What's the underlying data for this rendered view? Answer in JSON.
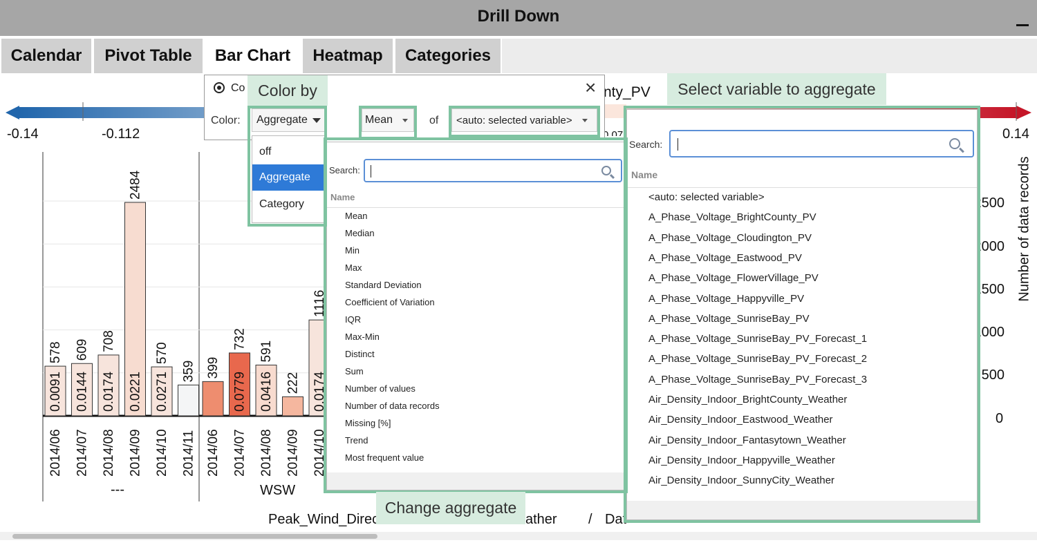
{
  "window": {
    "title": "Drill Down"
  },
  "tabs": [
    {
      "label": "Calendar",
      "active": false
    },
    {
      "label": "Pivot Table",
      "active": false
    },
    {
      "label": "Bar Chart",
      "active": true
    },
    {
      "label": "Heatmap",
      "active": false
    },
    {
      "label": "Categories",
      "active": false
    }
  ],
  "colorbar": {
    "min_label": "-0.14",
    "tick2": "-0.112",
    "max_label": "0.14",
    "low_color": "#2166ac",
    "high_color": "#c51628",
    "partial_title": "nty_PV",
    "partial_tick": "0.07"
  },
  "color_popup": {
    "title_partial": "Co",
    "color_label": "Color:",
    "color_value": "Aggregate",
    "aggregate_value": "Mean",
    "of_label": "of",
    "variable_value": "<auto: selected variable>",
    "close": "×",
    "color_options": [
      "off",
      "Aggregate",
      "Category"
    ],
    "selected_color_option": "Aggregate"
  },
  "aggregate_dropdown": {
    "search_label": "Search:",
    "search_value": "",
    "column_header": "Name",
    "items": [
      "Mean",
      "Median",
      "Min",
      "Max",
      "Standard Deviation",
      "Coefficient of Variation",
      "IQR",
      "Max-Min",
      "Distinct",
      "Sum",
      "Number of values",
      "Number of data records",
      "Missing [%]",
      "Trend",
      "Most frequent value"
    ]
  },
  "variable_dropdown": {
    "search_label": "Search:",
    "search_value": "",
    "column_header": "Name",
    "items": [
      "<auto: selected variable>",
      "A_Phase_Voltage_BrightCounty_PV",
      "A_Phase_Voltage_Cloudington_PV",
      "A_Phase_Voltage_Eastwood_PV",
      "A_Phase_Voltage_FlowerVillage_PV",
      "A_Phase_Voltage_Happyville_PV",
      "A_Phase_Voltage_SunriseBay_PV",
      "A_Phase_Voltage_SunriseBay_PV_Forecast_1",
      "A_Phase_Voltage_SunriseBay_PV_Forecast_2",
      "A_Phase_Voltage_SunriseBay_PV_Forecast_3",
      "Air_Density_Indoor_BrightCounty_Weather",
      "Air_Density_Indoor_Eastwood_Weather",
      "Air_Density_Indoor_Fantasytown_Weather",
      "Air_Density_Indoor_Happyville_Weather",
      "Air_Density_Indoor_SunnyCity_Weather"
    ]
  },
  "callouts": {
    "color_by": "Color by",
    "select_variable": "Select variable to aggregate",
    "change_aggregate": "Change aggregate"
  },
  "right_axis": {
    "label": "Number of data records",
    "ticks": [
      "2500",
      "2000",
      "1500",
      "1000",
      "500",
      "0"
    ]
  },
  "x_axis_partial": {
    "left_text": "Peak_Wind_Direc",
    "right_text": "ather",
    "separator": "/",
    "date_text": "DateTime (Year, Month)"
  },
  "chart_data": {
    "type": "bar",
    "groups": [
      {
        "name": "---",
        "categories": [
          "2014/06",
          "2014/07",
          "2014/08",
          "2014/09",
          "2014/10",
          "2014/11"
        ],
        "counts": [
          578,
          609,
          708,
          2484,
          570,
          359
        ],
        "means": [
          0.0091,
          0.0144,
          0.0174,
          0.0221,
          0.0271,
          null
        ],
        "colors": [
          "#f7e4dc",
          "#f7e4dc",
          "#f7e4dc",
          "#f7dcd0",
          "#f7e4dc",
          "#f4f5f6"
        ]
      },
      {
        "name": "WSW",
        "categories": [
          "2014/06",
          "2014/07",
          "2014/08",
          "2014/09",
          "2014/10"
        ],
        "counts": [
          399,
          732,
          591,
          222,
          1116
        ],
        "means": [
          null,
          0.0779,
          0.0416,
          null,
          0.0174
        ],
        "colors": [
          "#ee8d6f",
          "#e8684d",
          "#f8dbcf",
          "#f5b79f",
          "#f7e4dc"
        ]
      }
    ],
    "y2label": "Number of data records",
    "ylim": [
      0,
      2500
    ]
  }
}
